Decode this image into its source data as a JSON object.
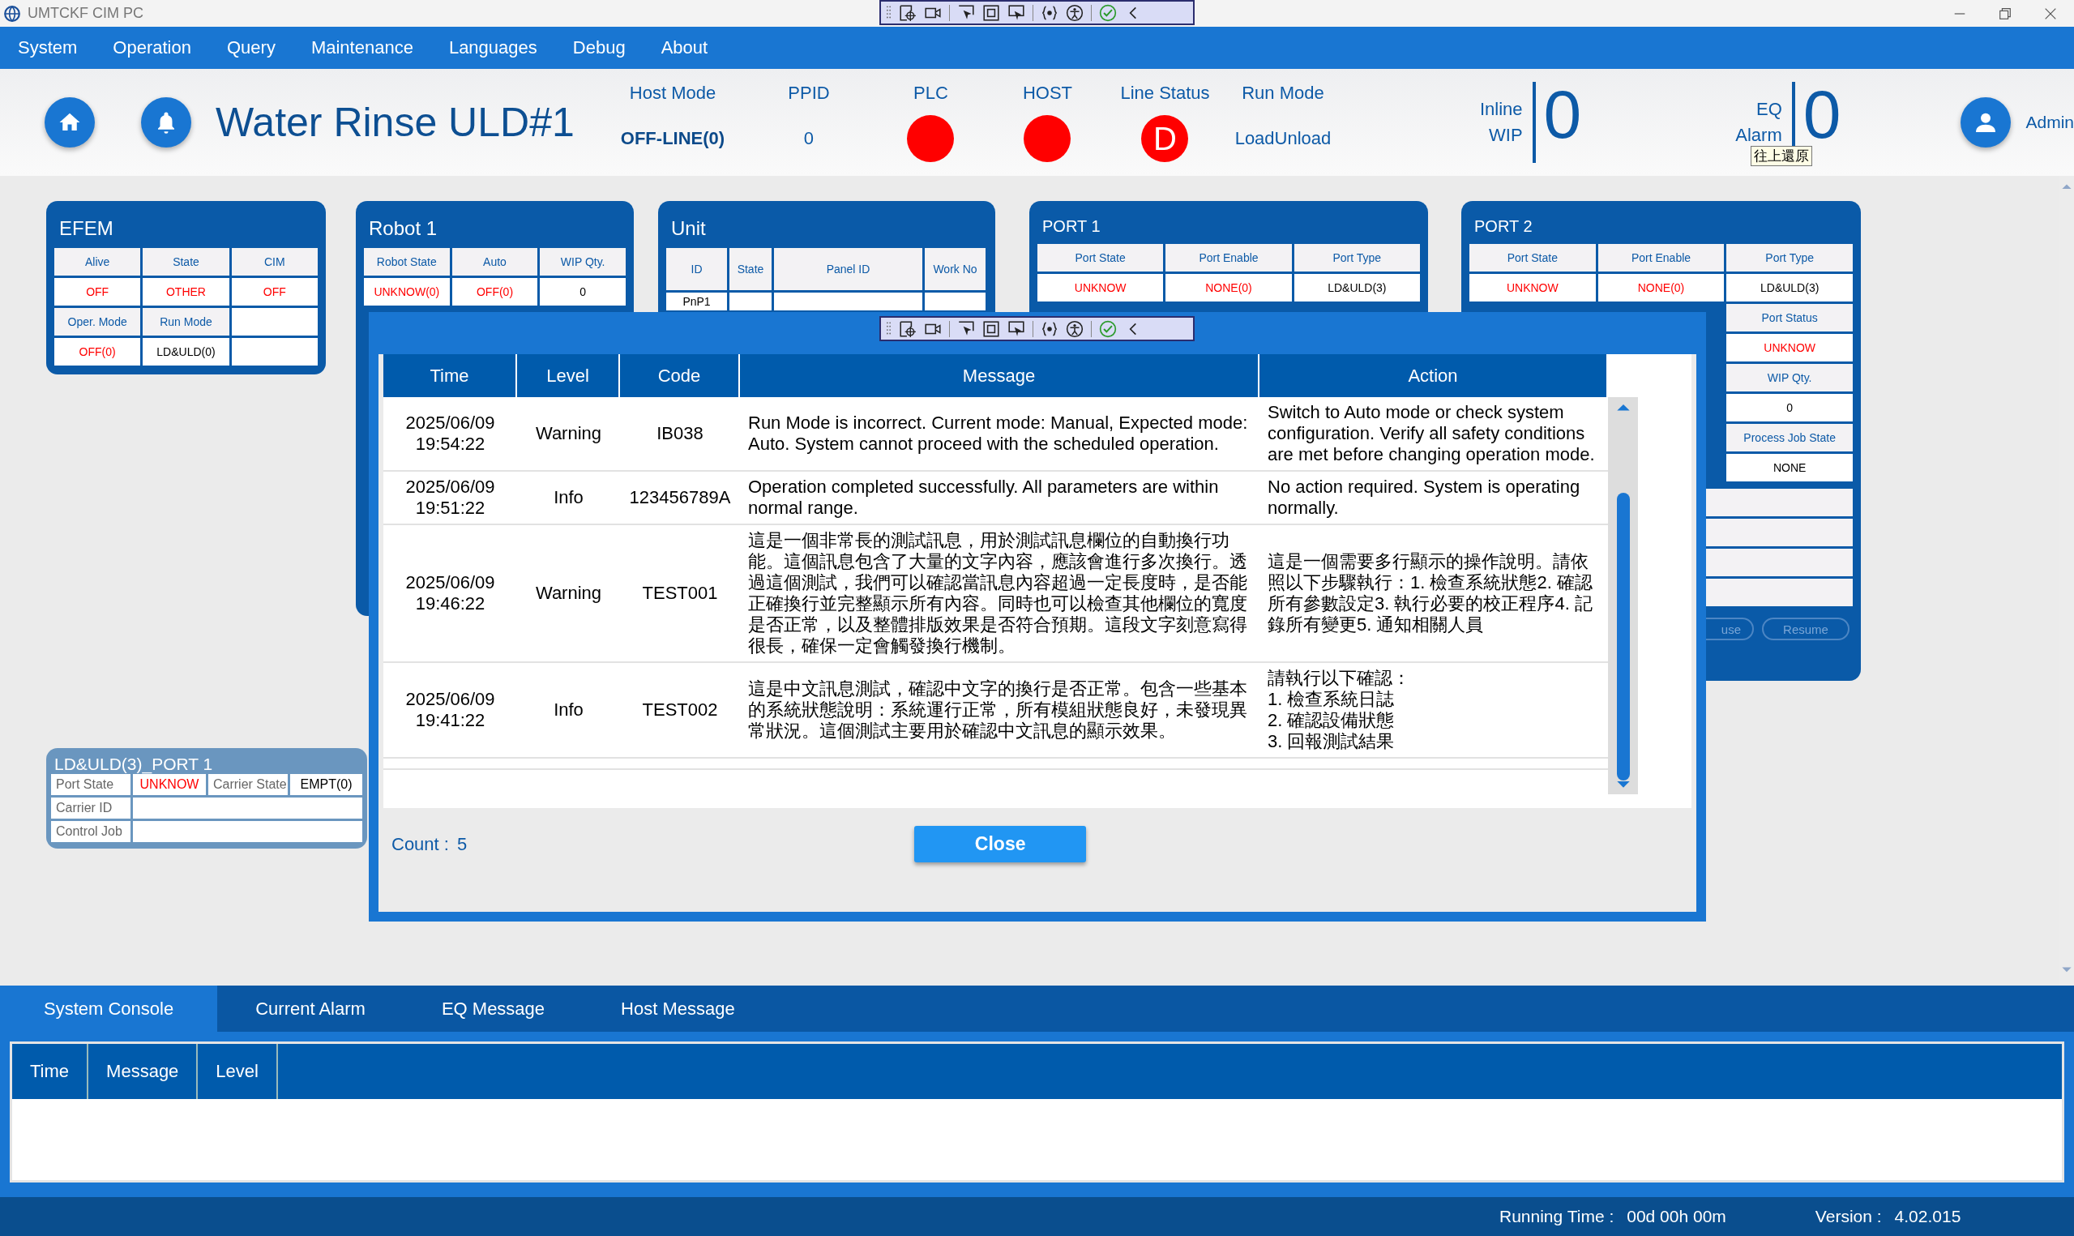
{
  "window": {
    "title": "UMTCKF CIM PC",
    "tooltip": "往上還原"
  },
  "menu": [
    "System",
    "Operation",
    "Query",
    "Maintenance",
    "Languages",
    "Debug",
    "About"
  ],
  "header": {
    "title": "Water Rinse ULD#1",
    "status": [
      {
        "kind": "emphasis",
        "label": "Host Mode",
        "value": "OFF-LINE(0)"
      },
      {
        "kind": "text",
        "label": "PPID",
        "value": "0"
      },
      {
        "kind": "lamp",
        "label": "PLC",
        "color": "#ff0000"
      },
      {
        "kind": "lamp",
        "label": "HOST",
        "color": "#ff0000"
      },
      {
        "kind": "lamp",
        "label": "Line Status",
        "color": "#ff0000",
        "value": "D"
      },
      {
        "kind": "text",
        "label": "Run Mode",
        "value": "LoadUnload"
      }
    ],
    "counters": [
      {
        "label": [
          "Inline",
          "WIP"
        ],
        "value": "0"
      },
      {
        "label": [
          "EQ",
          "Alarm"
        ],
        "value": "0"
      }
    ],
    "user": "Admin"
  },
  "panels": [
    {
      "title": "EFEM",
      "rows": [
        [
          {
            "kind": "head",
            "text": "Alive"
          },
          {
            "kind": "head",
            "text": "State"
          },
          {
            "kind": "head",
            "text": "CIM"
          }
        ],
        [
          {
            "kind": "value",
            "text": "OFF",
            "color": "#ff0000"
          },
          {
            "kind": "value",
            "text": "OTHER",
            "color": "#ff0000"
          },
          {
            "kind": "value",
            "text": "OFF",
            "color": "#ff0000"
          }
        ],
        [
          {
            "kind": "head",
            "text": "Oper. Mode"
          },
          {
            "kind": "head",
            "text": "Run Mode"
          },
          {
            "kind": "blank"
          }
        ],
        [
          {
            "kind": "value",
            "text": "OFF(0)",
            "color": "#ff0000"
          },
          {
            "kind": "value",
            "text": "LD&ULD(0)",
            "color": "#000000"
          },
          {
            "kind": "blank"
          }
        ]
      ]
    },
    {
      "title": "Robot 1",
      "rows": [
        [
          {
            "kind": "head",
            "text": "Robot State"
          },
          {
            "kind": "head",
            "text": "Auto"
          },
          {
            "kind": "head",
            "text": "WIP Qty."
          }
        ],
        [
          {
            "kind": "value",
            "text": "UNKNOW(0)",
            "color": "#ff0000"
          },
          {
            "kind": "value",
            "text": "OFF(0)",
            "color": "#ff0000"
          },
          {
            "kind": "value",
            "text": "0",
            "color": "#000000"
          }
        ]
      ]
    },
    {
      "title": "Unit",
      "rows": [
        [
          {
            "kind": "head",
            "text": "ID"
          },
          {
            "kind": "head",
            "text": "State"
          },
          {
            "kind": "head",
            "text": "Panel ID"
          },
          {
            "kind": "head",
            "text": "Work No"
          }
        ],
        [
          {
            "kind": "value",
            "text": "PnP1",
            "color": "#000000"
          },
          {
            "kind": "blank"
          },
          {
            "kind": "blank"
          },
          {
            "kind": "blank"
          }
        ]
      ]
    },
    {
      "title": "PORT 1",
      "rows": [
        [
          {
            "kind": "head",
            "text": "Port State"
          },
          {
            "kind": "head",
            "text": "Port Enable"
          },
          {
            "kind": "head",
            "text": "Port Type"
          }
        ],
        [
          {
            "kind": "value",
            "text": "UNKNOW",
            "color": "#ff0000"
          },
          {
            "kind": "value",
            "text": "NONE(0)",
            "color": "#ff0000"
          },
          {
            "kind": "value",
            "text": "LD&ULD(3)",
            "color": "#000000"
          }
        ]
      ]
    },
    {
      "title": "PORT 2",
      "rows": [
        [
          {
            "kind": "head",
            "text": "Port State"
          },
          {
            "kind": "head",
            "text": "Port Enable"
          },
          {
            "kind": "head",
            "text": "Port Type"
          }
        ],
        [
          {
            "kind": "value",
            "text": "UNKNOW",
            "color": "#ff0000"
          },
          {
            "kind": "value",
            "text": "NONE(0)",
            "color": "#ff0000"
          },
          {
            "kind": "value",
            "text": "LD&ULD(3)",
            "color": "#000000"
          }
        ],
        [
          {
            "kind": "head",
            "text": "Port Status"
          }
        ],
        [
          {
            "kind": "value",
            "text": "UNKNOW",
            "color": "#ff0000"
          }
        ],
        [
          {
            "kind": "head",
            "text": "WIP Qty."
          }
        ],
        [
          {
            "kind": "value",
            "text": "0",
            "color": "#000000"
          }
        ],
        [
          {
            "kind": "head",
            "text": "Process Job State"
          }
        ],
        [
          {
            "kind": "value",
            "text": "NONE",
            "color": "#000000"
          }
        ]
      ],
      "buttons": [
        "use",
        "Resume"
      ]
    }
  ],
  "port_panel": {
    "title": "LD&ULD(3)_PORT 1",
    "rows": [
      [
        {
          "kind": "label",
          "text": "Port State"
        },
        {
          "kind": "value",
          "text": "UNKNOW",
          "color": "#ff0000"
        },
        {
          "kind": "label",
          "text": "Carrier State"
        },
        {
          "kind": "value",
          "text": "EMPT(0)",
          "color": "#000000"
        }
      ],
      [
        {
          "kind": "label",
          "text": "Carrier ID"
        },
        {
          "kind": "wide"
        }
      ],
      [
        {
          "kind": "label",
          "text": "Control Job"
        },
        {
          "kind": "wide"
        }
      ]
    ]
  },
  "dialog": {
    "columns": [
      "Time",
      "Level",
      "Code",
      "Message",
      "Action"
    ],
    "rows": [
      {
        "date": "2025/06/09",
        "time": "19:54:22",
        "level": "Warning",
        "code": "IB038",
        "message": "Run Mode is incorrect. Current mode: Manual, Expected mode: Auto. System cannot proceed with the scheduled operation.",
        "action": "Switch to Auto mode or check system configuration. Verify all safety conditions are met before changing operation mode."
      },
      {
        "date": "2025/06/09",
        "time": "19:51:22",
        "level": "Info",
        "code": "123456789A",
        "message": "Operation completed successfully. All parameters are within normal range.",
        "action": "No action required. System is operating normally."
      },
      {
        "date": "2025/06/09",
        "time": "19:46:22",
        "level": "Warning",
        "code": "TEST001",
        "message": "這是一個非常長的測試訊息，用於測試訊息欄位的自動換行功能。這個訊息包含了大量的文字內容，應該會進行多次換行。透過這個測試，我們可以確認當訊息內容超過一定長度時，是否能正確換行並完整顯示所有內容。同時也可以檢查其他欄位的寬度是否正常，以及整體排版效果是否符合預期。這段文字刻意寫得很長，確保一定會觸發換行機制。",
        "action": "這是一個需要多行顯示的操作說明。請依照以下步驟執行：1. 檢查系統狀態2. 確認所有參數設定3. 執行必要的校正程序4. 記錄所有變更5. 通知相關人員"
      },
      {
        "date": "2025/06/09",
        "time": "19:41:22",
        "level": "Info",
        "code": "TEST002",
        "message": "這是中文訊息測試，確認中文字的換行是否正常。包含一些基本的系統狀態說明：系統運行正常，所有模組狀態良好，未發現異常狀況。這個測試主要用於確認中文訊息的顯示效果。",
        "action": "請執行以下確認：\n1. 檢查系統日誌\n2. 確認設備狀態\n3. 回報測試結果"
      }
    ],
    "count_label": "Count :",
    "count": "5",
    "close": "Close"
  },
  "console": {
    "tabs": [
      {
        "label": "System Console",
        "selected": true
      },
      {
        "label": "Current Alarm",
        "selected": false
      },
      {
        "label": "EQ Message",
        "selected": false
      },
      {
        "label": "Host Message",
        "selected": false
      }
    ],
    "columns": [
      "Time",
      "Message",
      "Level"
    ]
  },
  "status_bar": {
    "running_label": "Running Time :",
    "running": "00d 00h 00m",
    "version_label": "Version :",
    "version": "4.02.015"
  }
}
